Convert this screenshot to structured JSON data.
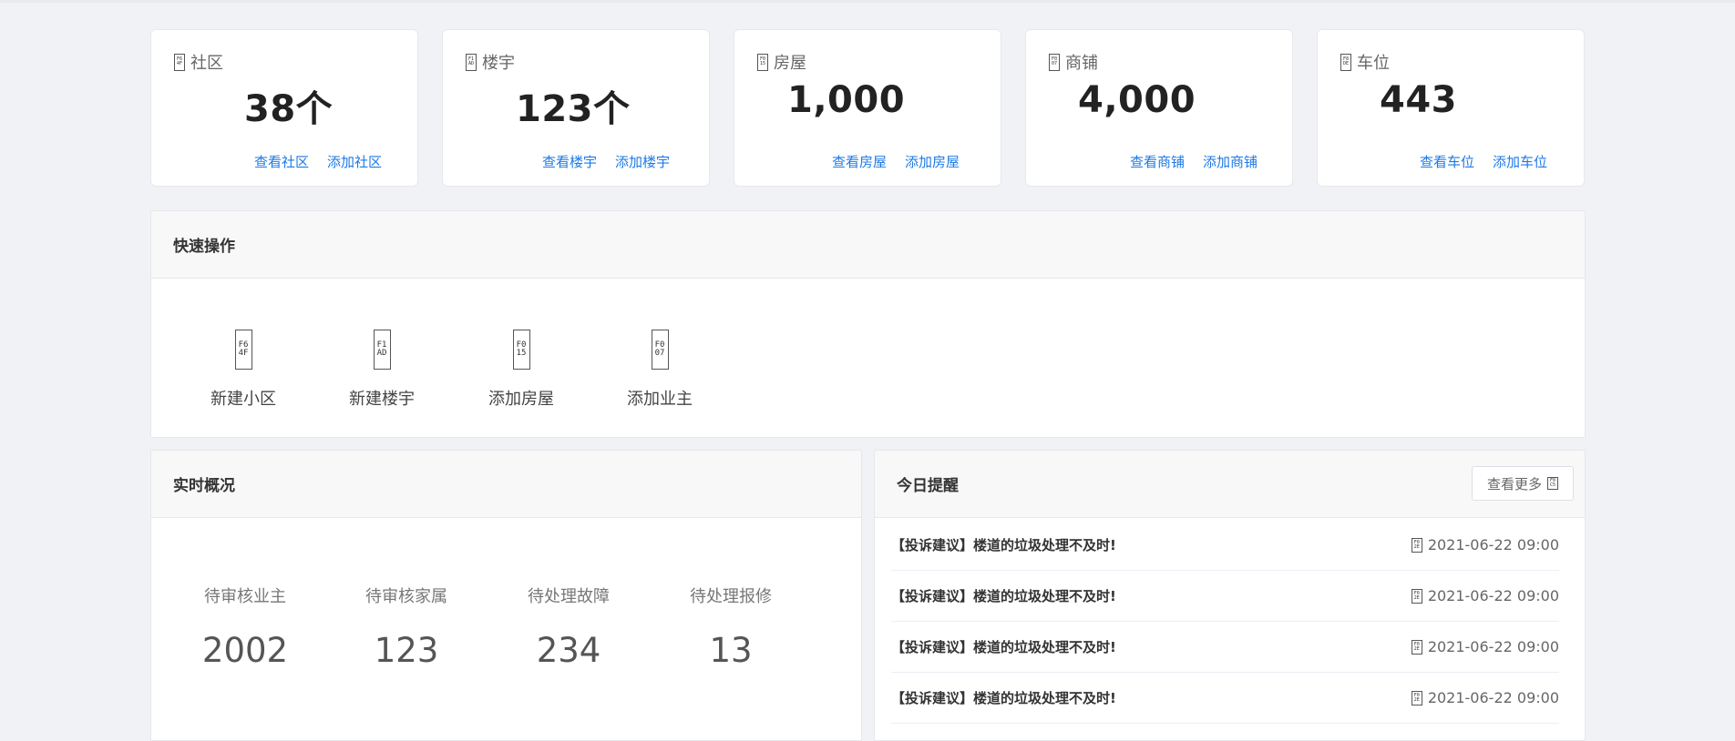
{
  "stats": [
    {
      "icon": "community-icon",
      "glyph": [
        "F6",
        "4F"
      ],
      "label": "社区",
      "value": "38个",
      "view": "查看社区",
      "add": "添加社区"
    },
    {
      "icon": "building-icon",
      "glyph": [
        "F1",
        "AD"
      ],
      "label": "楼宇",
      "value": "123个",
      "view": "查看楼宇",
      "add": "添加楼宇"
    },
    {
      "icon": "house-icon",
      "glyph": [
        "F0",
        "15"
      ],
      "label": "房屋",
      "value": "1,000",
      "view": "查看房屋",
      "add": "添加房屋"
    },
    {
      "icon": "shop-icon",
      "glyph": [
        "F0",
        "07"
      ],
      "label": "商铺",
      "value": "4,000",
      "view": "查看商铺",
      "add": "添加商铺"
    },
    {
      "icon": "parking-icon",
      "glyph": [
        "F8",
        "DE"
      ],
      "label": "车位",
      "value": "443",
      "view": "查看车位",
      "add": "添加车位"
    }
  ],
  "quick_actions": {
    "title": "快速操作",
    "items": [
      {
        "icon": "new-community-icon",
        "glyph": [
          "F6",
          "4F"
        ],
        "label": "新建小区"
      },
      {
        "icon": "new-building-icon",
        "glyph": [
          "F1",
          "AD"
        ],
        "label": "新建楼宇"
      },
      {
        "icon": "add-house-icon",
        "glyph": [
          "F0",
          "15"
        ],
        "label": "添加房屋"
      },
      {
        "icon": "add-owner-icon",
        "glyph": [
          "F0",
          "07"
        ],
        "label": "添加业主"
      }
    ]
  },
  "realtime": {
    "title": "实时概况",
    "items": [
      {
        "label": "待审核业主",
        "value": "2002"
      },
      {
        "label": "待审核家属",
        "value": "123"
      },
      {
        "label": "待处理故障",
        "value": "234"
      },
      {
        "label": "待处理报修",
        "value": "13"
      }
    ]
  },
  "reminders": {
    "title": "今日提醒",
    "more_label": "查看更多",
    "more_glyph": [
      "F0",
      "C5"
    ],
    "time_glyph": [
      "F0",
      "2E"
    ],
    "items": [
      {
        "title": "【投诉建议】楼道的垃圾处理不及时!",
        "time": "2021-06-22 09:00"
      },
      {
        "title": "【投诉建议】楼道的垃圾处理不及时!",
        "time": "2021-06-22 09:00"
      },
      {
        "title": "【投诉建议】楼道的垃圾处理不及时!",
        "time": "2021-06-22 09:00"
      },
      {
        "title": "【投诉建议】楼道的垃圾处理不及时!",
        "time": "2021-06-22 09:00"
      }
    ]
  },
  "colors": {
    "link": "#1e7ae6",
    "background": "#f0f2f5"
  }
}
